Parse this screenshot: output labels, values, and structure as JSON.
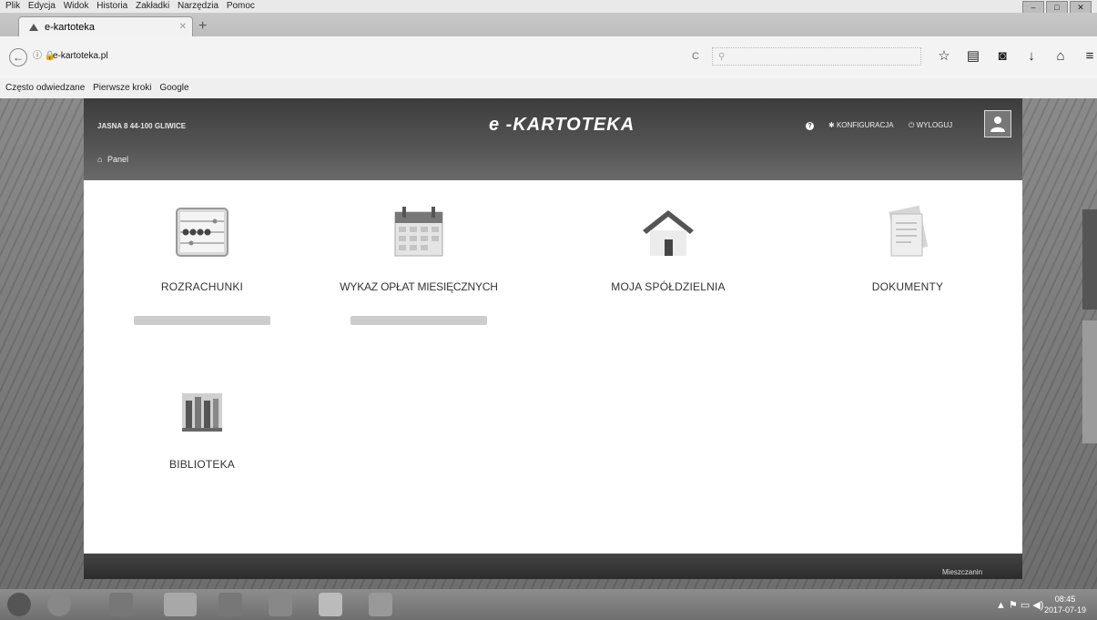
{
  "browser": {
    "menu": [
      "Plik",
      "Edycja",
      "Widok",
      "Historia",
      "Zakładki",
      "Narzędzia",
      "Pomoc"
    ],
    "tab_title": "e-kartoteka",
    "url_domain": "e-kartoteka.pl",
    "bookmarks": [
      "Często odwiedzane",
      "Pierwsze kroki",
      "Google"
    ]
  },
  "header": {
    "address": "JASNA 8 44-100 GLIWICE",
    "logo": "e -KARTOTEKA",
    "config": "KONFIGURACJA",
    "logout": "WYLOGUJ",
    "breadcrumb": "Panel"
  },
  "tiles": [
    {
      "label": "ROZRACHUNKI",
      "icon": "abacus-icon"
    },
    {
      "label": "WYKAZ OPŁAT MIESIĘCZNYCH",
      "icon": "calendar-icon"
    },
    {
      "label": "MOJA SPÓŁDZIELNIA",
      "icon": "house-icon"
    },
    {
      "label": "DOKUMENTY",
      "icon": "documents-icon"
    },
    {
      "label": "BIBLIOTEKA",
      "icon": "library-icon"
    }
  ],
  "footer": {
    "resident": "Mieszczanin"
  },
  "taskbar": {
    "time": "08:45",
    "date": "2017-07-19"
  },
  "colors": {
    "header": "#4a4a4a",
    "page": "#ffffff",
    "text": "#333333"
  }
}
